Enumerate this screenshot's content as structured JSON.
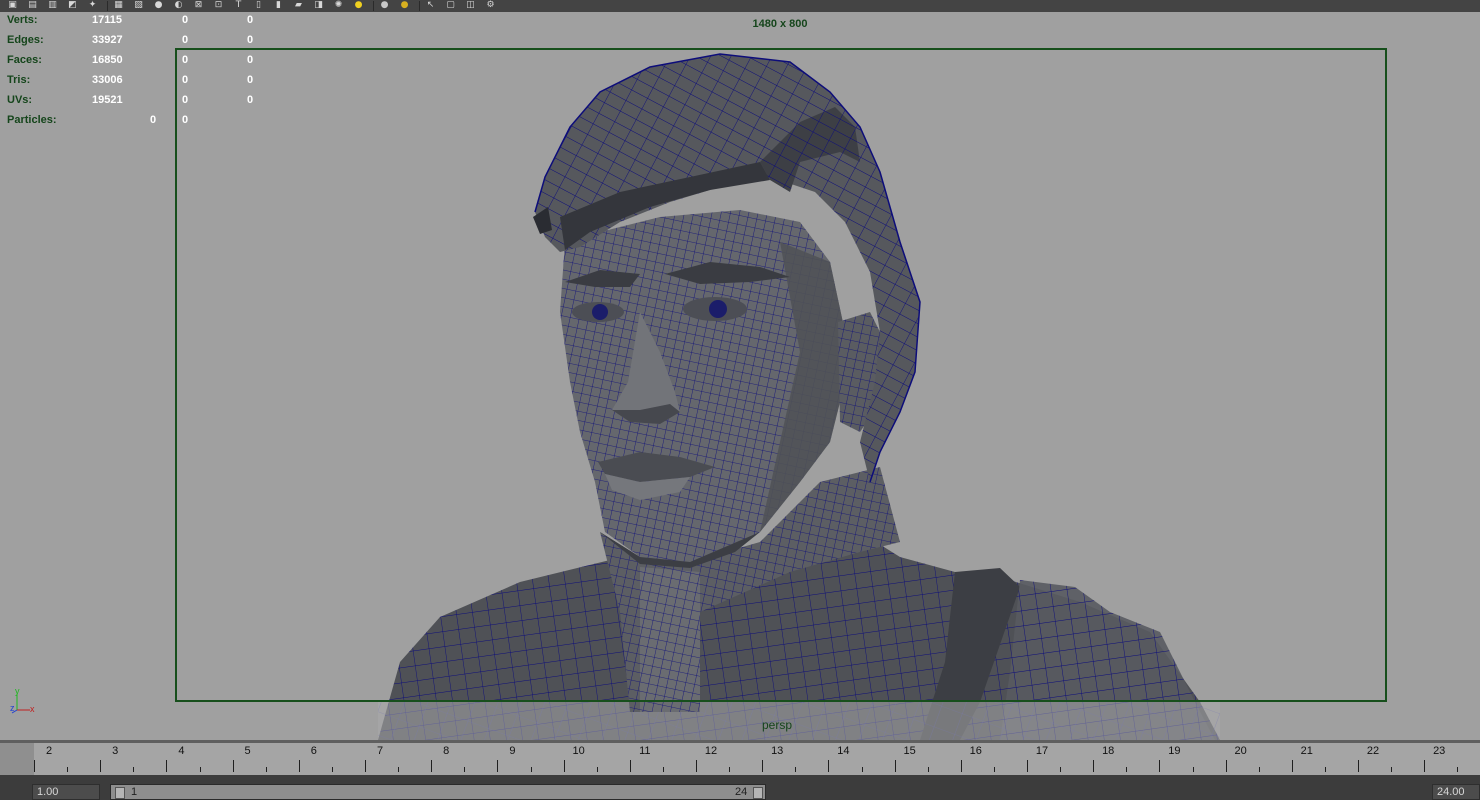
{
  "shelf": {
    "icons": [
      "render-frame-icon",
      "render-settings-icon",
      "hypershade-icon",
      "render-view-icon",
      "magnet-icon",
      "grid-icon",
      "film-gate-icon",
      "smooth-shade-icon",
      "flat-shade-icon",
      "wireframe-icon",
      "xray-icon",
      "texture-icon",
      "ipr-icon",
      "box-view-icon",
      "blue-box-icon",
      "xray-box-icon",
      "checker-icon",
      "lights-icon",
      "default-light-icon",
      "shadow-icon",
      "select-tool-icon",
      "cube-icon",
      "frame-all-icon",
      "share-icon"
    ]
  },
  "hud": {
    "stats": [
      {
        "label": "Verts:",
        "value": "17115",
        "sel": "0",
        "comp": "0"
      },
      {
        "label": "Edges:",
        "value": "33927",
        "sel": "0",
        "comp": "0"
      },
      {
        "label": "Faces:",
        "value": "16850",
        "sel": "0",
        "comp": "0"
      },
      {
        "label": "Tris:",
        "value": "33006",
        "sel": "0",
        "comp": "0"
      },
      {
        "label": "UVs:",
        "value": "19521",
        "sel": "0",
        "comp": "0"
      }
    ],
    "particles": {
      "label": "Particles:",
      "value": "0",
      "sel": "0"
    }
  },
  "viewport": {
    "resolution_gate_label": "1480 x 800",
    "camera_name": "persp",
    "axis": {
      "y": "y",
      "z": "z",
      "x": "x"
    },
    "colors": {
      "background": "#a0a0a0",
      "wire": "#0d0d7a",
      "hud_text": "#15451b",
      "gate": "#174f1c"
    }
  },
  "time_slider": {
    "frames": [
      "2",
      "3",
      "4",
      "5",
      "6",
      "7",
      "8",
      "9",
      "10",
      "11",
      "12",
      "13",
      "14",
      "15",
      "16",
      "17",
      "18",
      "19",
      "20",
      "21",
      "22",
      "23"
    ]
  },
  "range": {
    "start_value": "1.00",
    "range_start": "1",
    "range_end": "24",
    "end_value": "24.00"
  }
}
